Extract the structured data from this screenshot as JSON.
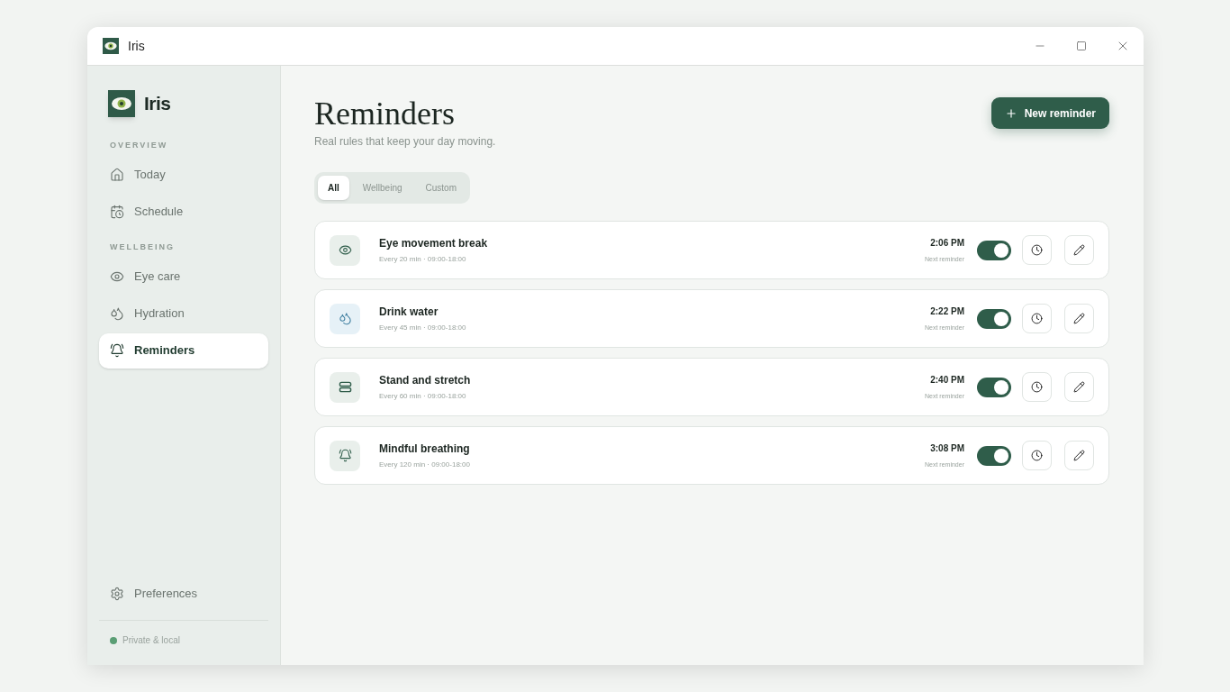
{
  "window": {
    "title": "Iris"
  },
  "sidebar": {
    "brand": "Iris",
    "sections": [
      {
        "heading": "OVERVIEW",
        "items": [
          {
            "label": "Today",
            "kind": "home",
            "selected": false
          },
          {
            "label": "Schedule",
            "kind": "calendar",
            "selected": false
          }
        ]
      },
      {
        "heading": "WELLBEING",
        "items": [
          {
            "label": "Eye care",
            "kind": "eye",
            "selected": false
          },
          {
            "label": "Hydration",
            "kind": "drops",
            "selected": false
          },
          {
            "label": "Reminders",
            "kind": "bell",
            "selected": true
          }
        ]
      }
    ],
    "footer_item": {
      "label": "Preferences",
      "selected": false
    },
    "status": {
      "label": "Private & local",
      "color": "#5a9e74"
    }
  },
  "main": {
    "title": "Reminders",
    "subtitle": "Real rules that keep your day moving.",
    "new_button": "New reminder",
    "tabs": [
      {
        "label": "All",
        "selected": true
      },
      {
        "label": "Wellbeing",
        "selected": false
      },
      {
        "label": "Custom",
        "selected": false
      }
    ],
    "reminders": [
      {
        "kind": "eye",
        "title": "Eye movement break",
        "detail": "Every 20 min · 09:00-18:00",
        "time": "2:06 PM",
        "caption": "Next reminder",
        "on": true
      },
      {
        "kind": "drops",
        "title": "Drink water",
        "detail": "Every 45 min · 09:00-18:00",
        "time": "2:22 PM",
        "caption": "Next reminder",
        "on": true
      },
      {
        "kind": "rows",
        "title": "Stand and stretch",
        "detail": "Every 60 min · 09:00-18:00",
        "time": "2:40 PM",
        "caption": "Next reminder",
        "on": true
      },
      {
        "kind": "bell",
        "title": "Mindful breathing",
        "detail": "Every 120 min · 09:00-18:00",
        "time": "3:08 PM",
        "caption": "Next reminder",
        "on": true
      }
    ]
  }
}
